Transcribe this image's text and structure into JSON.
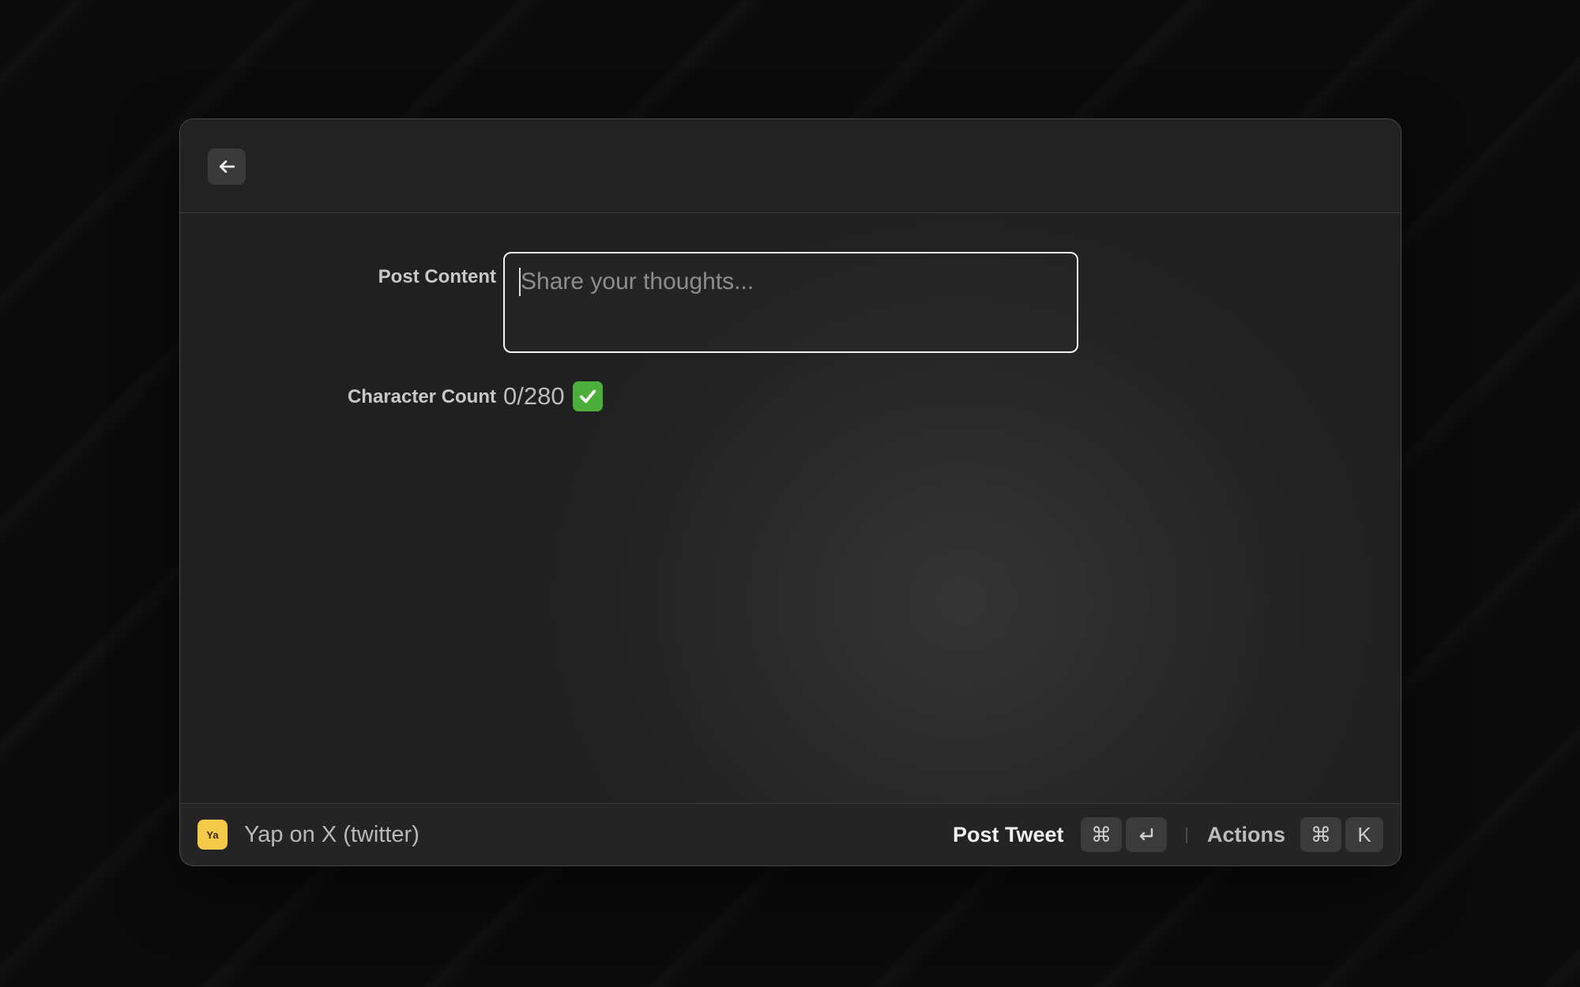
{
  "header": {
    "back_icon": "arrow-left-icon"
  },
  "form": {
    "post_content_label": "Post Content",
    "post_content_placeholder": "Share your thoughts...",
    "post_content_value": "",
    "character_count_label": "Character Count",
    "character_count_value": "0/280",
    "character_count_status_icon": "check-mark-button-icon"
  },
  "footer": {
    "app_icon_text": "Ya",
    "app_name": "Yap on X (twitter)",
    "primary_action_label": "Post Tweet",
    "primary_shortcut": [
      "⌘",
      "↵"
    ],
    "actions_label": "Actions",
    "actions_shortcut": [
      "⌘",
      "K"
    ]
  },
  "colors": {
    "app_icon_bg": "#f5c94a",
    "check_badge_bg": "#4caf3a",
    "input_border": "#f2f2f2"
  }
}
